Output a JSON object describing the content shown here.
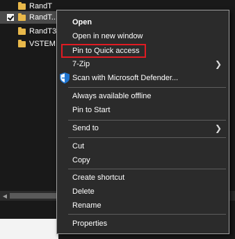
{
  "explorer": {
    "files": [
      {
        "name": "RandT",
        "checked": false,
        "selected": false
      },
      {
        "name": "RandT...",
        "checked": true,
        "selected": true
      },
      {
        "name": "RandT3",
        "checked": false,
        "selected": false
      },
      {
        "name": "VSTEM",
        "checked": false,
        "selected": false
      }
    ]
  },
  "context_menu": {
    "items": [
      {
        "label": "Open"
      },
      {
        "label": "Open in new window"
      },
      {
        "label": "Pin to Quick access"
      },
      {
        "label": "7-Zip"
      },
      {
        "label": "Scan with Microsoft Defender..."
      },
      {
        "label": "Always available offline"
      },
      {
        "label": "Pin to Start"
      },
      {
        "label": "Send to"
      },
      {
        "label": "Cut"
      },
      {
        "label": "Copy"
      },
      {
        "label": "Create shortcut"
      },
      {
        "label": "Delete"
      },
      {
        "label": "Rename"
      },
      {
        "label": "Properties"
      }
    ]
  },
  "colors": {
    "highlight_border": "#e11b22",
    "menu_background": "#2b2b2b",
    "folder": "#e8b84a"
  }
}
